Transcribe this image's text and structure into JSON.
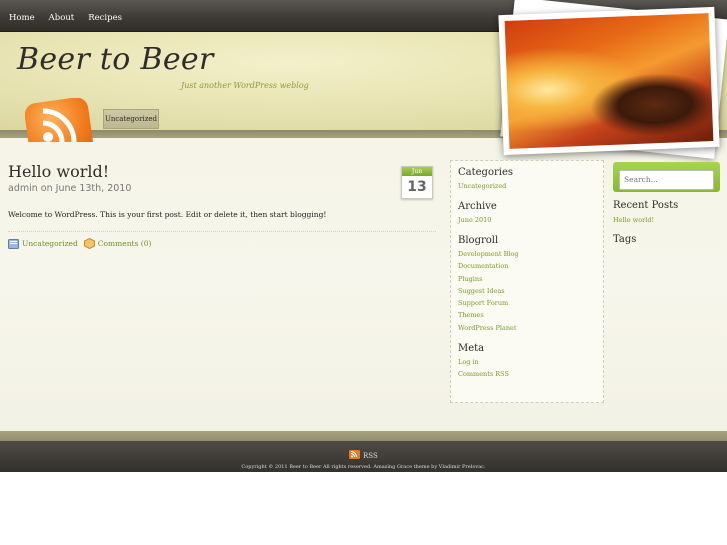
{
  "nav": {
    "items": [
      "Home",
      "About",
      "Recipes"
    ]
  },
  "header": {
    "title": "Beer to Beer",
    "tagline": "Just another WordPress weblog",
    "category_tab": "Uncategorized"
  },
  "post": {
    "title": "Hello world!",
    "meta": "admin on June 13th, 2010",
    "date_month": "Jun",
    "date_day": "13",
    "body": "Welcome to WordPress. This is your first post. Edit or delete it, then start blogging!",
    "category": "Uncategorized",
    "comments": "Comments (0)"
  },
  "sidebar": {
    "categories_title": "Categories",
    "categories": [
      "Uncategorized"
    ],
    "archive_title": "Archive",
    "archive": [
      "June 2010"
    ],
    "blogroll_title": "Blogroll",
    "blogroll": [
      "Development Blog",
      "Documentation",
      "Plugins",
      "Suggest Ideas",
      "Support Forum",
      "Themes",
      "WordPress Planet"
    ],
    "meta_title": "Meta",
    "meta": [
      "Log in",
      "Comments RSS"
    ]
  },
  "right": {
    "search_placeholder": "Search...",
    "recent_title": "Recent Posts",
    "recent": [
      "Hello world!"
    ],
    "tags_title": "Tags"
  },
  "footer": {
    "rss": "RSS",
    "copyright": "Copyright © 2011 Beer to Beer All rights reserved. Amazing Grace theme by Vladimir Prelovac."
  },
  "colors": {
    "accent_green": "#7a9a2c",
    "nav_bar": "#3f3c37",
    "rss_orange": "#f07a1b"
  }
}
